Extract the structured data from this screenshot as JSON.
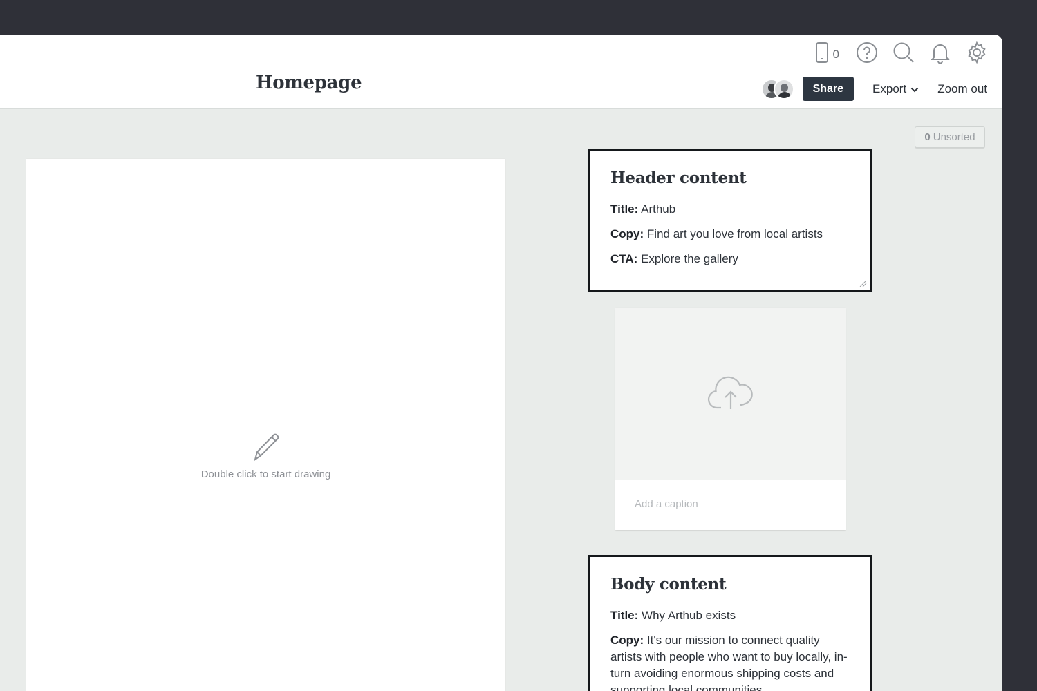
{
  "header": {
    "title": "Homepage",
    "device_count": "0",
    "share_label": "Share",
    "export_label": "Export",
    "zoom_label": "Zoom out"
  },
  "icons": [
    "phone-icon",
    "help-icon",
    "search-icon",
    "bell-icon",
    "gear-icon",
    "chevron-down-icon",
    "pencil-icon",
    "cloud-upload-icon"
  ],
  "board": {
    "unsorted_count": "0",
    "unsorted_label": "Unsorted"
  },
  "sketch": {
    "hint": "Double click to start drawing"
  },
  "header_note": {
    "heading": "Header content",
    "fields": [
      {
        "label": "Title:",
        "value": "Arthub"
      },
      {
        "label": "Copy:",
        "value": "Find art you love from local artists"
      },
      {
        "label": "CTA:",
        "value": "Explore the gallery"
      }
    ]
  },
  "image_card": {
    "caption_placeholder": "Add a caption"
  },
  "body_note": {
    "heading": "Body content",
    "fields": [
      {
        "label": "Title:",
        "value": "Why Arthub exists"
      },
      {
        "label": "Copy:",
        "value": "It's our mission to connect quality artists with people who want to buy locally, in-turn avoiding enormous shipping costs and supporting local communities."
      }
    ]
  },
  "colors": {
    "app_background": "#2f3038",
    "board_background": "#e9ecea",
    "share_button": "#2d3641",
    "note_border": "#15181b"
  }
}
